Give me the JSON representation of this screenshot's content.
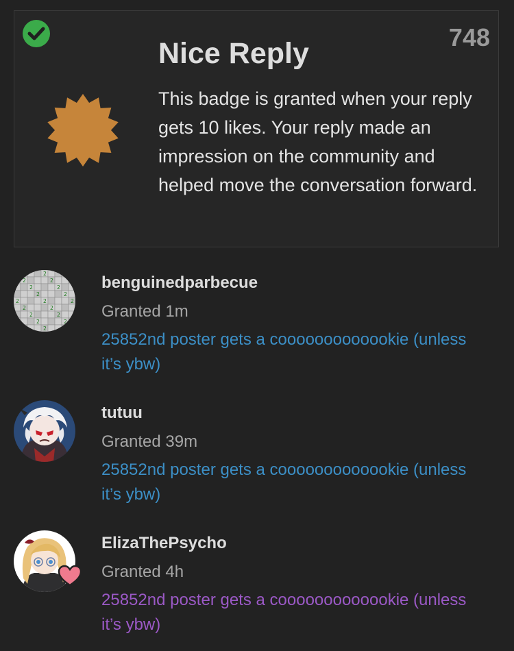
{
  "badge": {
    "title": "Nice Reply",
    "description": "This badge is granted when your reply gets 10 likes. Your reply made an impression on the community and helped move the conversation forward.",
    "grant_count": "748",
    "badge_color": "#c6853a",
    "status_icon": "check-circle-icon",
    "status_color": "#3bab4a"
  },
  "grants": [
    {
      "username": "benguinedparbecue",
      "granted": "Granted 1m",
      "post_title": "25852nd poster gets a cooooooooooookie (unless it’s ybw)",
      "link_color": "#3c8fc6",
      "avatar_icon": "minesweeper-avatar"
    },
    {
      "username": "tutuu",
      "granted": "Granted 39m",
      "post_title": "25852nd poster gets a cooooooooooookie (unless it’s ybw)",
      "link_color": "#3c8fc6",
      "avatar_icon": "anime-white-hair-avatar"
    },
    {
      "username": "ElizaThePsycho",
      "granted": "Granted 4h",
      "post_title": "25852nd poster gets a cooooooooooookie (unless it’s ybw)",
      "link_color": "#9b59c6",
      "avatar_icon": "anime-blonde-avatar",
      "flair_icon": "heart-icon"
    }
  ]
}
